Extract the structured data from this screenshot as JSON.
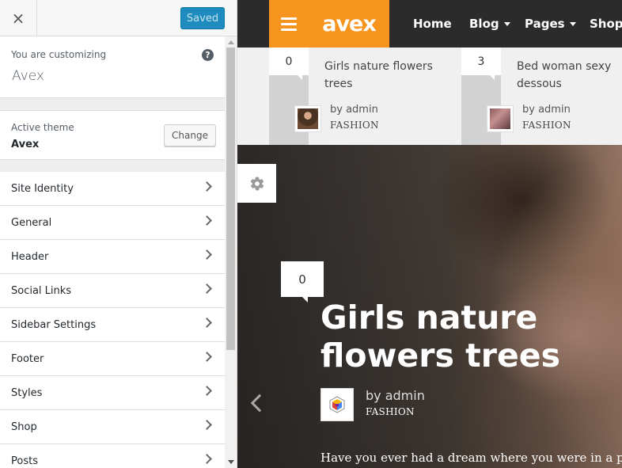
{
  "customizer": {
    "close_icon": "×",
    "saved_label": "Saved",
    "info": {
      "label": "You are customizing",
      "site_name": "Avex",
      "help_icon": "?"
    },
    "theme": {
      "label": "Active theme",
      "name": "Avex",
      "change_label": "Change"
    },
    "sections": [
      {
        "label": "Site Identity"
      },
      {
        "label": "General"
      },
      {
        "label": "Header"
      },
      {
        "label": "Social Links"
      },
      {
        "label": "Sidebar Settings"
      },
      {
        "label": "Footer"
      },
      {
        "label": "Styles"
      },
      {
        "label": "Shop"
      },
      {
        "label": "Posts"
      }
    ]
  },
  "preview": {
    "logo": "avex",
    "nav": [
      {
        "label": "Home",
        "has_dropdown": false
      },
      {
        "label": "Blog",
        "has_dropdown": true
      },
      {
        "label": "Pages",
        "has_dropdown": true
      },
      {
        "label": "Shop",
        "has_dropdown": false
      }
    ],
    "strip_posts": [
      {
        "count": "0",
        "title_line1": "Girls nature flowers",
        "title_line2": "trees",
        "by": "by  admin",
        "category": "FASHION"
      },
      {
        "count": "3",
        "title_line1": "Bed woman sexy",
        "title_line2": "dessous",
        "by": "by  admin",
        "category": "FASHION"
      }
    ],
    "hero": {
      "count": "0",
      "title_line1": "Girls nature",
      "title_line2": "flowers trees",
      "by": "by  admin",
      "category": "FASHION",
      "excerpt": "Have you ever had a dream where you were in a place,"
    }
  },
  "colors": {
    "accent_orange": "#f7941d",
    "nav_dark": "#2b2b2b",
    "saved_blue": "#1e8cbe"
  }
}
